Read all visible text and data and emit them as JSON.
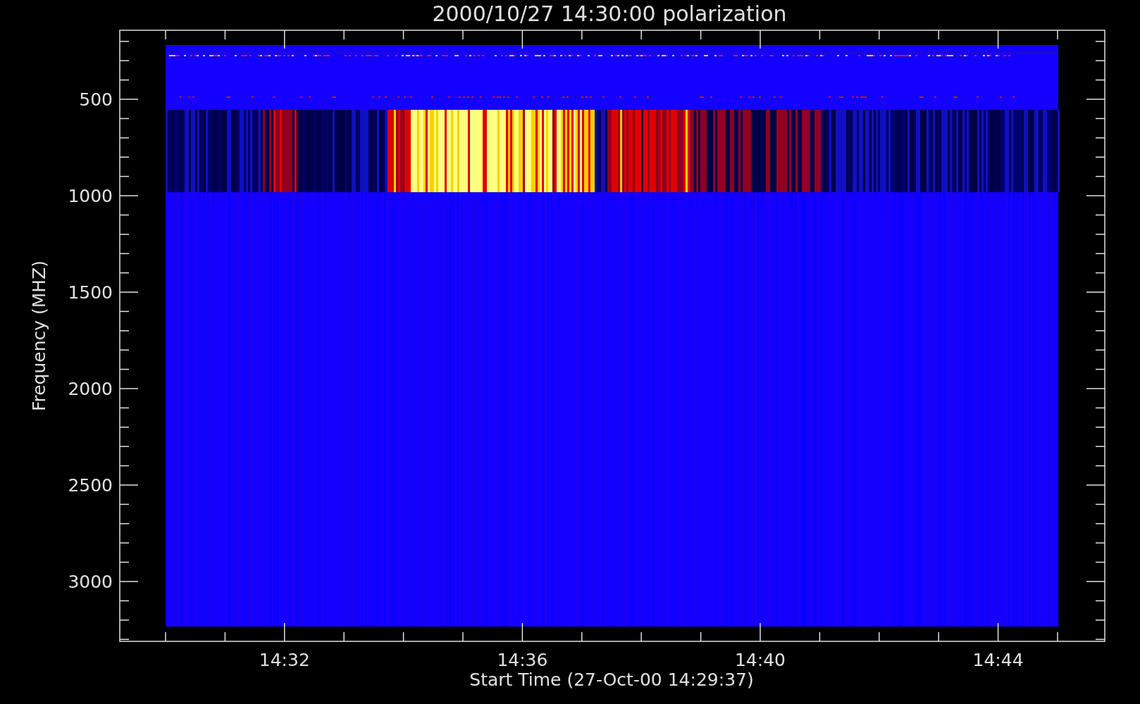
{
  "title": "2000/10/27 14:30:00 polarization",
  "y_axis": {
    "label": "Frequency (MHZ)",
    "tick_labels": [
      "500",
      "1000",
      "1500",
      "2000",
      "2500",
      "3000"
    ]
  },
  "x_axis": {
    "label": "Start Time (27-Oct-00 14:29:37)",
    "tick_labels": [
      "14:32",
      "14:36",
      "14:40",
      "14:44"
    ]
  }
}
